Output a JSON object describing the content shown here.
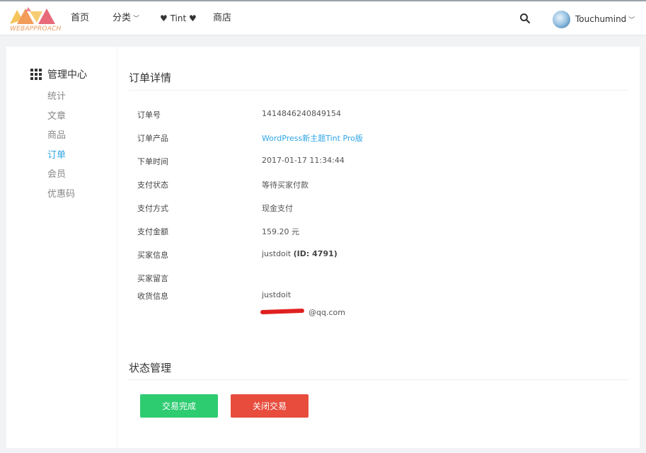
{
  "brand": {
    "logo_text": "WEBAPPROACH",
    "colors": {
      "orange": "#f39c5a",
      "pink": "#e86a7a",
      "yellow": "#f5c45a"
    }
  },
  "nav": {
    "home": "首页",
    "category": "分类",
    "tint": "♥ Tint ♥",
    "shop": "商店",
    "search_icon": "search-icon",
    "user_name": "Touchumind"
  },
  "sidebar": {
    "title": "管理中心",
    "items": [
      {
        "label": "统计"
      },
      {
        "label": "文章"
      },
      {
        "label": "商品"
      },
      {
        "label": "订单",
        "active": true
      },
      {
        "label": "会员"
      },
      {
        "label": "优惠码"
      }
    ]
  },
  "order": {
    "section_title": "订单详情",
    "rows": [
      {
        "label": "订单号",
        "value": "1414846240849154"
      },
      {
        "label": "订单产品",
        "value": "WordPress新主题Tint Pro版"
      },
      {
        "label": "下单时间",
        "value": "2017-01-17 11:34:44"
      },
      {
        "label": "支付状态",
        "value": "等待买家付款"
      },
      {
        "label": "支付方式",
        "value": "现金支付"
      },
      {
        "label": "支付金额",
        "value": "159.20 元"
      },
      {
        "label": "买家信息",
        "value": "justdoit",
        "value_id": "(ID: 4791)"
      },
      {
        "label": "买家留言",
        "value": ""
      },
      {
        "label": "收货信息",
        "value": "justdoit",
        "value2": "@qq.com"
      }
    ]
  },
  "status": {
    "section_title": "状态管理",
    "complete_label": "交易完成",
    "close_label": "关闭交易",
    "colors": {
      "complete": "#2ecc71",
      "close": "#e74c3c",
      "link": "#2ea6e6"
    }
  }
}
